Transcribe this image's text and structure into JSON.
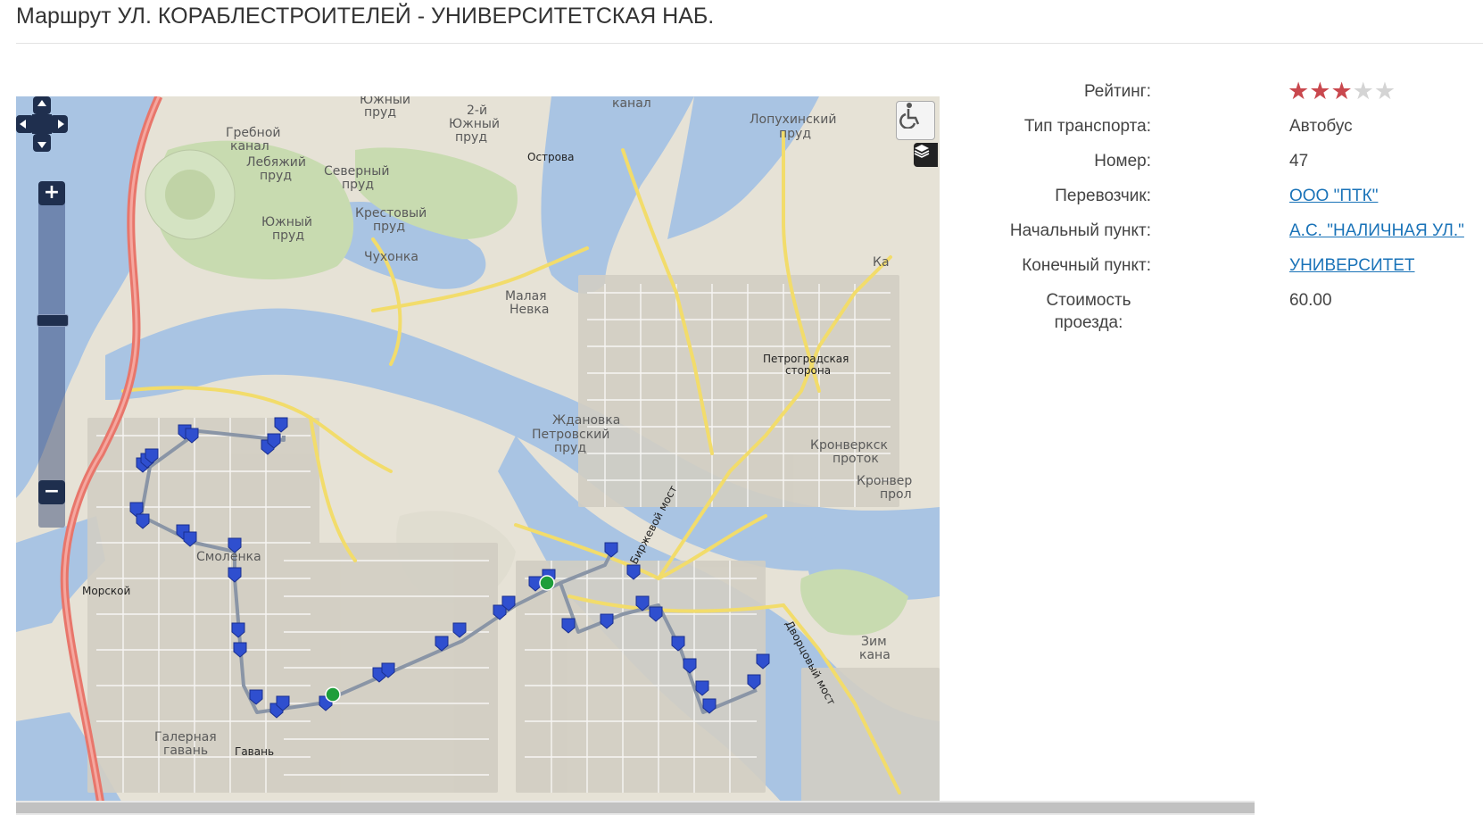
{
  "page": {
    "title": "Маршрут УЛ. КОРАБЛЕСТРОИТЕЛЕЙ - УНИВЕРСИТЕТСКАЯ НАБ."
  },
  "map": {
    "controls": {
      "zoom_in_label": "+",
      "zoom_out_label": "−",
      "pan_icon": "pan-arrows-icon",
      "accessibility_icon": "wheelchair-icon",
      "layers_icon": "layers-icon"
    },
    "labels": [
      "Южный пруд",
      "2-й Южный пруд",
      "канал",
      "Лопухинский пруд",
      "Гребной канал",
      "Лебяжий пруд",
      "Северный пруд",
      "Крестовый пруд",
      "Южный пруд",
      "Острова",
      "Чухонка",
      "Малая Невка",
      "Петроградская сторона",
      "Ждановка",
      "Петровский пруд",
      "Кронверкский проток",
      "Кронвер прол",
      "Смоленка",
      "Морской",
      "Биржевой мост",
      "Дворцовый мост",
      "Зим кана",
      "Галерная гавань",
      "Гавань",
      "Ка"
    ],
    "route_color": "#8a95a6",
    "stop_marker_color": "#2f4fcf",
    "terminal_marker_color": "#1e9e3a"
  },
  "info": {
    "rating_label": "Рейтинг:",
    "rating_value": 3,
    "rating_max": 5,
    "transport_type_label": "Тип транспорта:",
    "transport_type": "Автобус",
    "number_label": "Номер:",
    "number": "47",
    "carrier_label": "Перевозчик:",
    "carrier": "ООО \"ПТК\"",
    "start_label": "Начальный пункт:",
    "start": "А.С. \"НАЛИЧНАЯ УЛ.\"",
    "end_label": "Конечный пункт:",
    "end": "УНИВЕРСИТЕТ",
    "price_label": "Стоимость проезда:",
    "price": "60.00",
    "star_filled_color": "#c9484e",
    "star_empty_color": "#d4d4d4"
  }
}
